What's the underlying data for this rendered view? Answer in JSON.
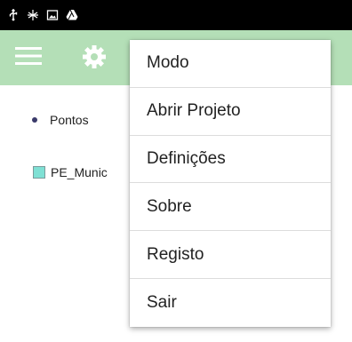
{
  "status_bar": {
    "icons": [
      "usb-icon",
      "bug-icon",
      "image-icon",
      "drive-icon"
    ]
  },
  "toolbar": {
    "menu_icon": "hamburger-menu-icon",
    "settings_icon": "gear-icon",
    "background": "#b4dfb7"
  },
  "layers": [
    {
      "label": "Pontos",
      "symbol": "point",
      "color": "#3a3a6a"
    },
    {
      "label": "PE_Munic",
      "symbol": "polygon",
      "color": "#7fe0d4"
    }
  ],
  "overflow_menu": {
    "items": [
      {
        "label": "Modo"
      },
      {
        "label": "Abrir Projeto"
      },
      {
        "label": "Definições"
      },
      {
        "label": "Sobre"
      },
      {
        "label": "Registo"
      },
      {
        "label": "Sair"
      }
    ]
  }
}
